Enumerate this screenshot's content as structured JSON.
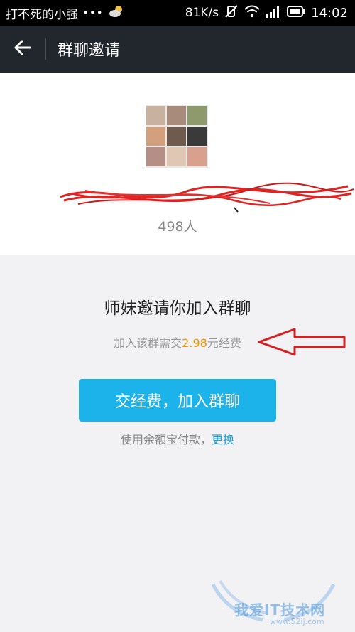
{
  "status_bar": {
    "carrier": "打不死的小强",
    "dots": "•••",
    "speed": "81K/s",
    "time": "14:02",
    "icons": [
      "weather-cloud-icon",
      "mute-icon",
      "wifi-icon",
      "signal-icon",
      "battery-icon"
    ]
  },
  "header": {
    "back_icon": "back-arrow-icon",
    "title": "群聊邀请"
  },
  "group": {
    "member_count": "498人",
    "avatar_colors": [
      "#c9b1a0",
      "#a88b7a",
      "#8f9a6c",
      "#d2a07c",
      "#6f5a4e",
      "#3a3a3a",
      "#b58e86",
      "#e0c7b3",
      "#d9a18d"
    ]
  },
  "invite": {
    "title": "师妹邀请你加入群聊",
    "fee_prefix": "加入该群需交",
    "fee_amount": "2.98",
    "fee_suffix": "元经费",
    "join_button": "交经费，加入群聊",
    "pay_prefix": "使用余额宝付款，",
    "pay_change": "更换"
  },
  "watermark": {
    "text": "我爱IT技术网",
    "url": "www.52ij.com"
  },
  "colors": {
    "accent": "#1cb3ea",
    "fee": "#f29100",
    "header": "#22262d",
    "annotation": "#d61f1f"
  }
}
